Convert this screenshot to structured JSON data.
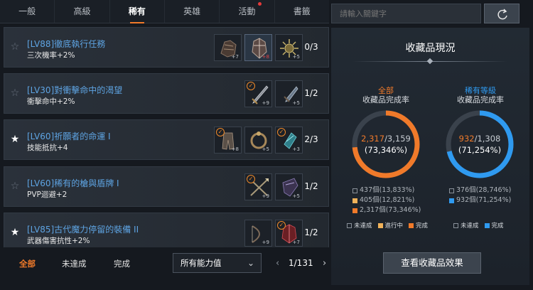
{
  "tabs": [
    {
      "label": "一般",
      "active": false
    },
    {
      "label": "高級",
      "active": false
    },
    {
      "label": "稀有",
      "active": true
    },
    {
      "label": "英雄",
      "active": false
    },
    {
      "label": "活動",
      "active": false,
      "notification": true
    },
    {
      "label": "書籤",
      "active": false
    }
  ],
  "rows": [
    {
      "title": "[LV88]徹底執行任務",
      "stat": "三次機率+2%",
      "starred": false,
      "count": "0/3",
      "slots": [
        {
          "icon": "gauntlet-icon",
          "enh": "+7",
          "checked": false,
          "selected": false
        },
        {
          "icon": "spiked-armor-icon",
          "enh": "+8",
          "checked": false,
          "selected": true
        },
        {
          "icon": "sun-amulet-icon",
          "enh": "+5",
          "checked": false,
          "selected": false
        }
      ]
    },
    {
      "title": "[LV30]對衝擊命中的渴望",
      "stat": "衝擊命中+2%",
      "starred": false,
      "count": "1/2",
      "slots": [
        {
          "icon": "sword-icon",
          "enh": "+9",
          "checked": true,
          "selected": false
        },
        {
          "icon": "dagger-icon",
          "enh": "+5",
          "checked": false,
          "selected": false
        }
      ]
    },
    {
      "title": "[LV60]祈願者的命運 I",
      "stat": "技能抵抗+4",
      "starred": true,
      "count": "2/3",
      "slots": [
        {
          "icon": "leg-armor-icon",
          "enh": "+8",
          "checked": true,
          "selected": false
        },
        {
          "icon": "ring-icon",
          "enh": "+5",
          "checked": false,
          "selected": false
        },
        {
          "icon": "gem-icon",
          "enh": "+3",
          "checked": true,
          "selected": false
        }
      ]
    },
    {
      "title": "[LV60]稀有的槍與盾牌 I",
      "stat": "PVP迴避+2",
      "starred": false,
      "count": "1/2",
      "slots": [
        {
          "icon": "crossed-spears-icon",
          "enh": "+9",
          "checked": true,
          "selected": false
        },
        {
          "icon": "shield-icon",
          "enh": "+5",
          "checked": false,
          "selected": false
        }
      ]
    },
    {
      "title": "[LV85]古代魔力停留的裝備 II",
      "stat": "武器傷害抗性+2%",
      "starred": true,
      "count": "1/2",
      "slots": [
        {
          "icon": "bow-icon",
          "enh": "+9",
          "checked": false,
          "selected": false
        },
        {
          "icon": "crimson-armor-icon",
          "enh": "+7",
          "checked": true,
          "selected": false
        }
      ]
    }
  ],
  "filters": [
    {
      "label": "全部",
      "active": true
    },
    {
      "label": "未達成",
      "active": false
    },
    {
      "label": "完成",
      "active": false
    }
  ],
  "ability_select": {
    "value": "所有能力值"
  },
  "pager": {
    "text": "1/131"
  },
  "search": {
    "placeholder": "請輸入關鍵字"
  },
  "panel": {
    "title": "收藏品現況",
    "overall": {
      "head": "全部",
      "sub": "收藏品完成率",
      "done": "2,317",
      "total": "/3,159",
      "percent": "(73,346%)",
      "fraction": 0.7335,
      "stats": [
        "437個(13,833%)",
        "405個(12,821%)",
        "2,317個(73,346%)"
      ]
    },
    "rare": {
      "head": "稀有等級",
      "sub": "收藏品完成率",
      "done": "932",
      "total": "/1,308",
      "percent": "(71,254%)",
      "fraction": 0.7125,
      "stats": [
        "376個(28,746%)",
        "932個(71,254%)"
      ]
    },
    "legend_left": [
      "未達成",
      "進行中",
      "完成"
    ],
    "legend_right": [
      "未達成",
      "完成"
    ],
    "effect_button": "查看收藏品效果"
  },
  "colors": {
    "accent_orange": "#f07a2a",
    "accent_blue": "#2f9af0",
    "quest_title": "#5ea4e3"
  }
}
